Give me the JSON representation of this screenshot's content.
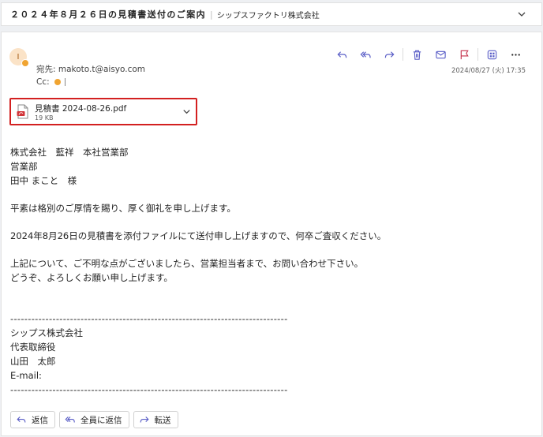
{
  "subject": {
    "title": "２０２４年８月２６日の見積書送付のご案内",
    "separator": "|",
    "company": "シップスファクトリ株式会社"
  },
  "sender": {
    "avatar_initial": "I",
    "to": "宛先: makoto.t@aisyo.com",
    "cc_label": "Cc:",
    "timestamp": "2024/08/27 (火) 17:35"
  },
  "toolbar": {
    "icons": [
      "reply-icon",
      "reply-all-icon",
      "forward-icon",
      "delete-icon",
      "mark-unread-icon",
      "flag-icon",
      "apps-icon",
      "more-icon"
    ],
    "more_label": "···",
    "accent": "#5b5fc7",
    "delete_color": "#5b5fc7",
    "flag_color": "#c4314b"
  },
  "attachment": {
    "name": "見積書 2024-08-26.pdf",
    "size": "19 KB",
    "highlight": "#d32020"
  },
  "body": {
    "l1": "株式会社　藍祥　本社営業部",
    "l2": "営業部",
    "l3": "田中 まこと　様",
    "l4": "平素は格別のご厚情を賜り、厚く御礼を申し上げます。",
    "l5": "2024年8月26日の見積書を添付ファイルにて送付申し上げますので、何卒ご査収ください。",
    "l6": "上記について、ご不明な点がございましたら、営業担当者まで、お問い合わせ下さい。",
    "l7": "どうぞ、よろしくお願い申し上げます。",
    "divider": "-------------------------------------------------------------------------------",
    "s1": "シップス株式会社",
    "s2": "代表取締役",
    "s3": "山田　太郎",
    "s4": "E-mail:"
  },
  "actions": {
    "reply": "返信",
    "reply_all": "全員に返信",
    "forward": "転送"
  }
}
